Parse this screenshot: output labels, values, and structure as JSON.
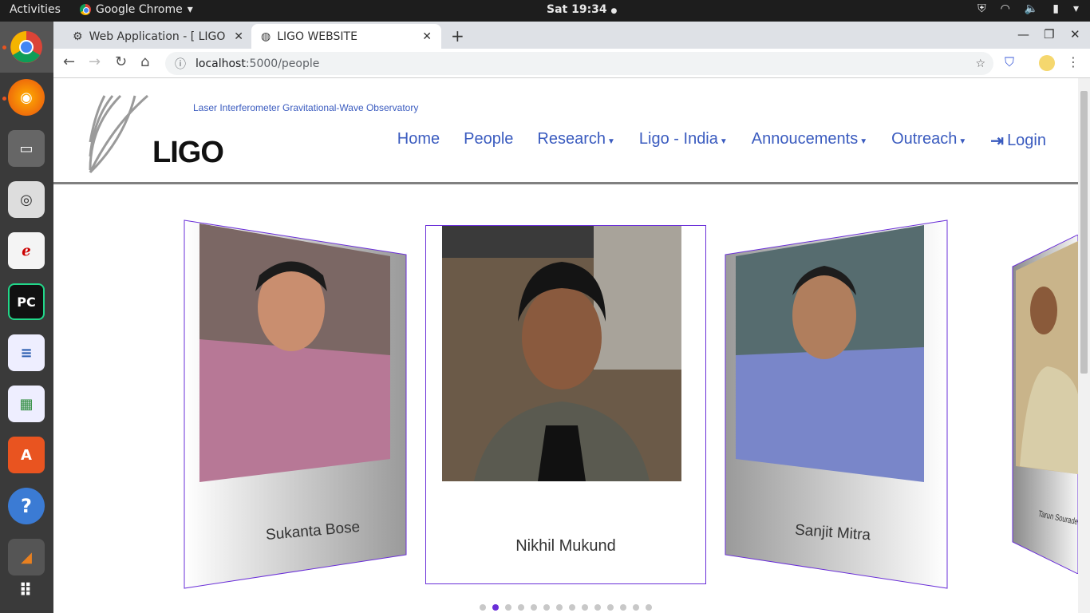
{
  "system": {
    "activities": "Activities",
    "app_name": "Google Chrome",
    "clock": "Sat 19:34"
  },
  "browser": {
    "tabs": [
      {
        "title": "Web Application - [ LIGO ]",
        "active": false
      },
      {
        "title": "LIGO WEBSITE",
        "active": true
      }
    ],
    "url_host": "localhost",
    "url_path": ":5000/people"
  },
  "site": {
    "logo_text": "LIGO",
    "tagline": "Laser Interferometer Gravitational-Wave Observatory",
    "nav": {
      "home": "Home",
      "people": "People",
      "research": "Research",
      "ligo_india": "Ligo - India",
      "announcements": "Annoucements",
      "outreach": "Outreach",
      "login": "Login"
    },
    "people": [
      {
        "name": "Sukanta Bose"
      },
      {
        "name": "Nikhil Mukund"
      },
      {
        "name": "Sanjit Mitra"
      },
      {
        "name": "Tarun Souradeep"
      }
    ],
    "carousel": {
      "total_slides": 14,
      "active_index": 1
    }
  },
  "colors": {
    "accent": "#6a2fd8",
    "link": "#3a5bbf"
  }
}
